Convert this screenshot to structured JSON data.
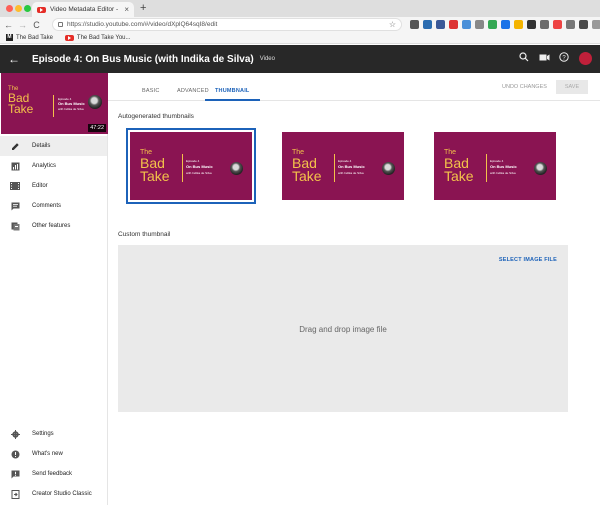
{
  "browser": {
    "tab_title": "Video Metadata Editor - YouTu...",
    "tab_close": "×",
    "new_tab": "+",
    "url": "https://studio.youtube.com/#/video/dXplQ64sqI8/edit",
    "back": "←",
    "forward": "→",
    "reload": "C",
    "bookmark_star": "☆",
    "bookmarks": [
      {
        "label": "The Bad Take",
        "icon": "M"
      },
      {
        "label": "The Bad Take You..."
      }
    ],
    "colors": {
      "close": "#fe5f57",
      "minimize": "#febc2e",
      "zoom": "#28c840"
    }
  },
  "header": {
    "back_icon": "←",
    "title": "Episode 4: On Bus Music (with Indika de Silva)",
    "subtitle": "Video",
    "icons": [
      "search-icon",
      "create-video-icon",
      "help-icon",
      "account-avatar"
    ]
  },
  "sidebar": {
    "duration": "47:22",
    "items": [
      {
        "label": "Details",
        "icon": "pencil-icon",
        "active": true
      },
      {
        "label": "Analytics",
        "icon": "analytics-icon"
      },
      {
        "label": "Editor",
        "icon": "editor-icon"
      },
      {
        "label": "Comments",
        "icon": "comments-icon"
      },
      {
        "label": "Other features",
        "icon": "other-features-icon"
      }
    ],
    "bottom_items": [
      {
        "label": "Settings",
        "icon": "gear-icon"
      },
      {
        "label": "What's new",
        "icon": "info-icon"
      },
      {
        "label": "Send feedback",
        "icon": "feedback-icon"
      },
      {
        "label": "Creator Studio Classic",
        "icon": "classic-icon"
      }
    ]
  },
  "tabs": [
    {
      "label": "BASIC"
    },
    {
      "label": "ADVANCED"
    },
    {
      "label": "THUMBNAIL",
      "active": true
    }
  ],
  "actions": {
    "undo": "UNDO CHANGES",
    "save": "SAVE"
  },
  "thumbnail_art": {
    "line1": "The",
    "line2": "Bad",
    "line3": "Take",
    "episode": "Episode 4",
    "topic": "On Bus Music",
    "guest": "with Indika de Silva"
  },
  "autogenerated": {
    "label": "Autogenerated thumbnails",
    "selected_index": 0,
    "count": 3
  },
  "custom": {
    "label": "Custom thumbnail",
    "select_label": "SELECT IMAGE FILE",
    "drop_text": "Drag and drop image file"
  },
  "colors": {
    "accent": "#1c62b9",
    "thumb_bg": "#8a1452",
    "thumb_text": "#f3c24a",
    "header_bg": "#282828"
  }
}
